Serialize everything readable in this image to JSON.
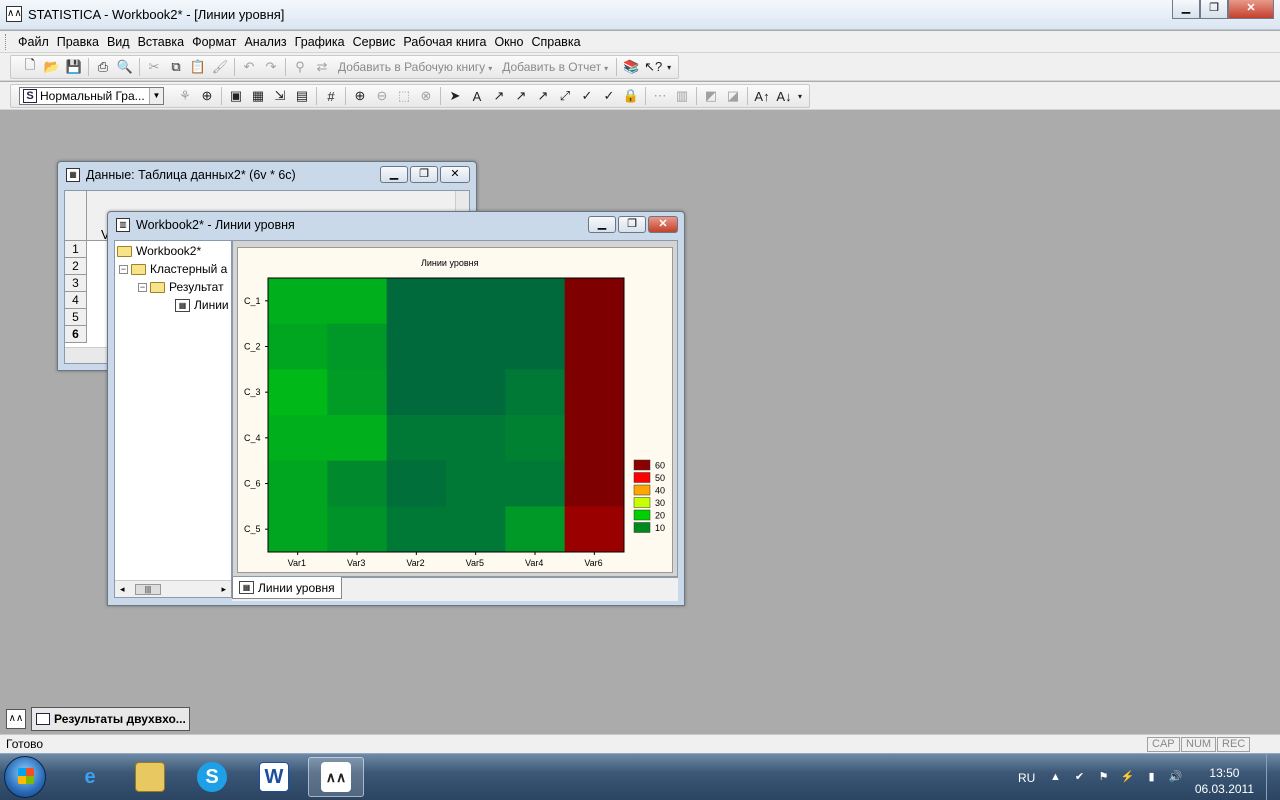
{
  "app": {
    "title": "STATISTICA - Workbook2* - [Линии уровня]",
    "caption_minimize": "▁",
    "caption_restore": "❐",
    "caption_close": "✕"
  },
  "menu": [
    "Файл",
    "Правка",
    "Вид",
    "Вставка",
    "Формат",
    "Анализ",
    "Графика",
    "Сервис",
    "Рабочая книга",
    "Окно",
    "Справка"
  ],
  "toolbar1": {
    "add_to_workbook": "Добавить в Рабочую книгу",
    "add_to_report": "Добавить в Отчет",
    "dropdown_arrow": "▾"
  },
  "toolbar2": {
    "style_combo_value": "Нормальный Гра...",
    "style_combo_icon": "S"
  },
  "data_window": {
    "title": "Данные: Таблица данных2* (6v * 6c)",
    "col_header_first": "V",
    "row_numbers": [
      "1",
      "2",
      "3",
      "4",
      "5",
      "6"
    ]
  },
  "workbook_window": {
    "title": "Workbook2* - Линии уровня",
    "tree": {
      "root": "Workbook2*",
      "level1": "Кластерный а",
      "level2": "Результат",
      "level3": "Линии"
    },
    "tab_label": "Линии уровня"
  },
  "chart_data": {
    "type": "heatmap",
    "title": "Линии уровня",
    "x_categories": [
      "Var1",
      "Var3",
      "Var2",
      "Var5",
      "Var4",
      "Var6"
    ],
    "y_categories": [
      "C_1",
      "C_2",
      "C_3",
      "C_4",
      "C_6",
      "C_5"
    ],
    "values": [
      [
        20,
        20,
        5,
        5,
        5,
        65
      ],
      [
        18,
        15,
        5,
        5,
        5,
        65
      ],
      [
        22,
        16,
        5,
        5,
        8,
        65
      ],
      [
        20,
        20,
        8,
        8,
        10,
        65
      ],
      [
        18,
        12,
        6,
        8,
        8,
        65
      ],
      [
        18,
        14,
        8,
        8,
        15,
        55
      ]
    ],
    "legend": {
      "levels": [
        "60",
        "50",
        "40",
        "30",
        "20",
        "10"
      ],
      "colors": [
        "#8b0000",
        "#ff0000",
        "#ffa500",
        "#c8ff00",
        "#00d000",
        "#008a1e"
      ],
      "placement": "right"
    },
    "colors": {
      "low": "#006a3c",
      "mid": "#00b818",
      "high_max": "#7f0000",
      "high": "#9a0000"
    }
  },
  "mdi_taskbar": {
    "item": "Результаты двухвхо..."
  },
  "status": {
    "text": "Готово",
    "indicators": [
      "CAP",
      "NUM",
      "REC"
    ]
  },
  "taskbar": {
    "lang": "RU",
    "time": "13:50",
    "date": "06.03.2011",
    "apps": [
      "ie-icon",
      "explorer-icon",
      "skype-icon",
      "word-icon",
      "statistica-icon"
    ]
  }
}
